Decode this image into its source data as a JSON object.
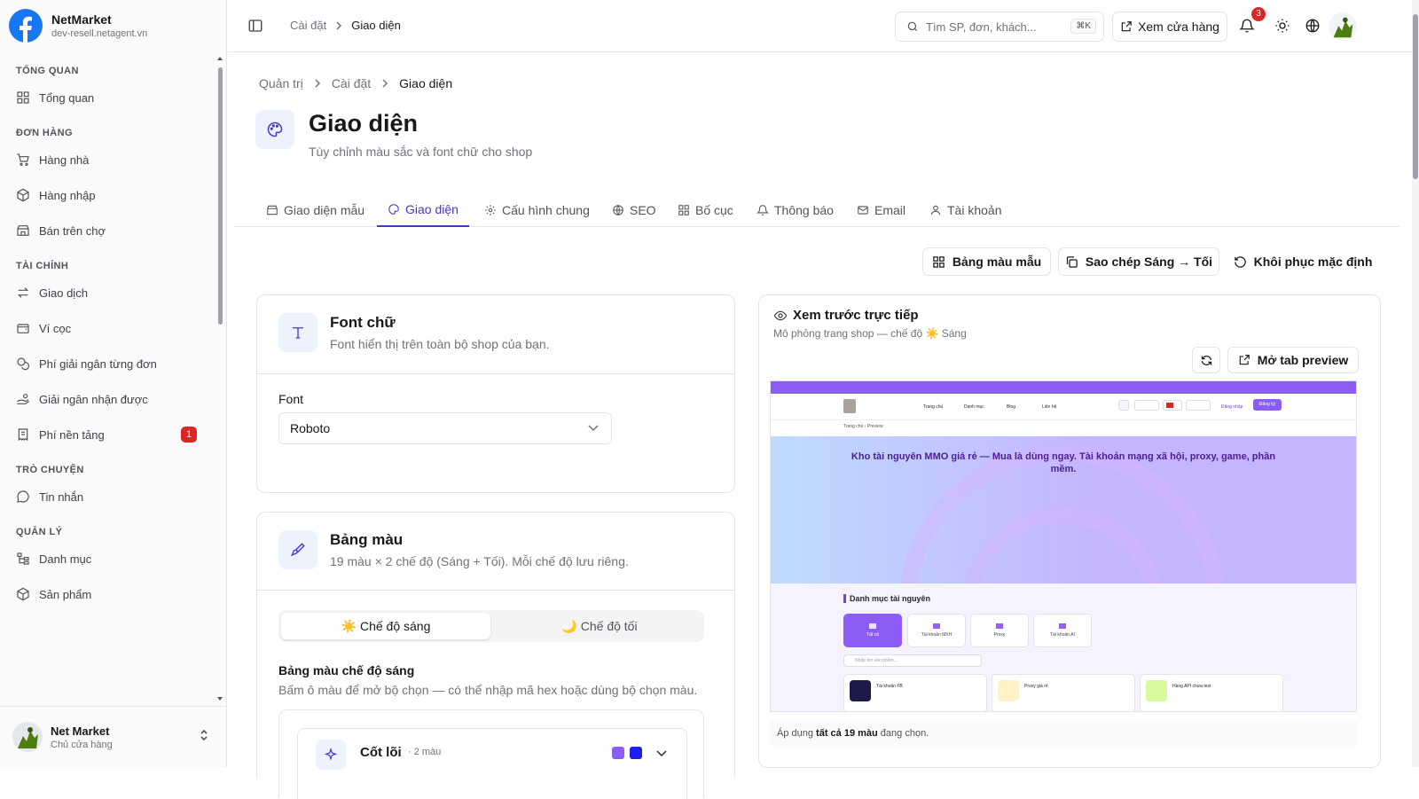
{
  "app": {
    "name": "NetMarket",
    "domain": "dev-resell.netagent.vn"
  },
  "sidebar": {
    "sections": [
      {
        "title": "TỔNG QUAN",
        "items": [
          {
            "label": "Tổng quan",
            "icon": "grid-icon"
          }
        ]
      },
      {
        "title": "ĐƠN HÀNG",
        "items": [
          {
            "label": "Hàng nhà",
            "icon": "cart-icon"
          },
          {
            "label": "Hàng nhập",
            "icon": "package-icon"
          },
          {
            "label": "Bán trên chợ",
            "icon": "store-icon"
          }
        ]
      },
      {
        "title": "TÀI CHÍNH",
        "items": [
          {
            "label": "Giao dịch",
            "icon": "swap-icon"
          },
          {
            "label": "Ví cọc",
            "icon": "wallet-icon"
          },
          {
            "label": "Phí giải ngân từng đơn",
            "icon": "coins-icon"
          },
          {
            "label": "Giải ngân nhận được",
            "icon": "handcoins-icon"
          },
          {
            "label": "Phí nền tảng",
            "icon": "receipt-icon",
            "badge": "1"
          }
        ]
      },
      {
        "title": "TRÒ CHUYỆN",
        "items": [
          {
            "label": "Tin nhắn",
            "icon": "chat-icon"
          }
        ]
      },
      {
        "title": "QUẢN LÝ",
        "items": [
          {
            "label": "Danh mục",
            "icon": "tree-icon"
          },
          {
            "label": "Sản phẩm",
            "icon": "box-icon"
          }
        ]
      }
    ],
    "user": {
      "name": "Net Market",
      "role": "Chủ cửa hàng"
    }
  },
  "topbar": {
    "crumb": [
      "Cài đặt",
      "Giao diện"
    ],
    "search_placeholder": "Tìm SP, đơn, khách...",
    "search_kbd": "⌘K",
    "store_button": "Xem cửa hàng",
    "notif_count": "3"
  },
  "page": {
    "breadcrumb": [
      "Quản trị",
      "Cài đặt",
      "Giao diện"
    ],
    "title": "Giao diện",
    "subtitle": "Tùy chỉnh màu sắc và font chữ cho shop",
    "tabs": [
      {
        "label": "Giao diện mẫu",
        "icon": "store-icon"
      },
      {
        "label": "Giao diện",
        "icon": "palette-icon",
        "active": true
      },
      {
        "label": "Cấu hình chung",
        "icon": "gear-icon"
      },
      {
        "label": "SEO",
        "icon": "globe-icon"
      },
      {
        "label": "Bố cục",
        "icon": "grid-icon"
      },
      {
        "label": "Thông báo",
        "icon": "bell-icon"
      },
      {
        "label": "Email",
        "icon": "mail-icon"
      },
      {
        "label": "Tài khoản",
        "icon": "user-icon"
      }
    ],
    "actions": {
      "palette": "Bảng màu mẫu",
      "copy": "Sao chép Sáng → Tối",
      "restore": "Khôi phục mặc định"
    }
  },
  "font_card": {
    "title": "Font chữ",
    "desc": "Font hiển thị trên toàn bộ shop của bạn.",
    "field_label": "Font",
    "value": "Roboto"
  },
  "palette_card": {
    "title": "Bảng màu",
    "desc": "19 màu × 2 chế độ (Sáng + Tối). Mỗi chế độ lưu riêng.",
    "mode_light": "☀️ Chế độ sáng",
    "mode_dark": "🌙 Chế độ tối",
    "heading": "Bảng màu chế độ sáng",
    "hint": "Bấm ô màu để mở bộ chọn — có thể nhập mã hex hoặc dùng bộ chọn màu.",
    "group_name": "Cốt lõi",
    "group_count": "· 2 màu",
    "swatches": [
      "#8b5cf6",
      "#1d1df0"
    ]
  },
  "preview": {
    "title": "Xem trước trực tiếp",
    "subtitle": "Mô phỏng trang shop — chế độ ☀️ Sáng",
    "open_tab": "Mở tab preview",
    "footer_pre": "Áp dụng ",
    "footer_bold": "tất cả 19 màu",
    "footer_post": " đang chọn.",
    "site": {
      "nav": [
        "Trang chủ",
        "Danh mục",
        "Blog",
        "Liên hệ"
      ],
      "login": "Đăng nhập",
      "register": "Đăng ký",
      "crumb": "Trang chủ  ›  Preview",
      "hero": "Kho tài nguyên MMO giá rẻ — Mua là dùng ngay. Tài khoản mạng xã hội, proxy, game, phần mềm.",
      "cat_title": "Danh mục tài nguyên",
      "cats": [
        "Tất cả",
        "Tài khoản MXH",
        "Proxy",
        "Tài khoản AI"
      ],
      "search": "Nhập tên sản phẩm...",
      "products": [
        "Tài khoản FB",
        "Proxy giá rẻ",
        "Hàng API chưa test"
      ]
    }
  },
  "colors": {
    "accent": "#4338ca",
    "brand": "#1877f2",
    "badge": "#dc2626",
    "preview_primary": "#8b5cf6"
  }
}
